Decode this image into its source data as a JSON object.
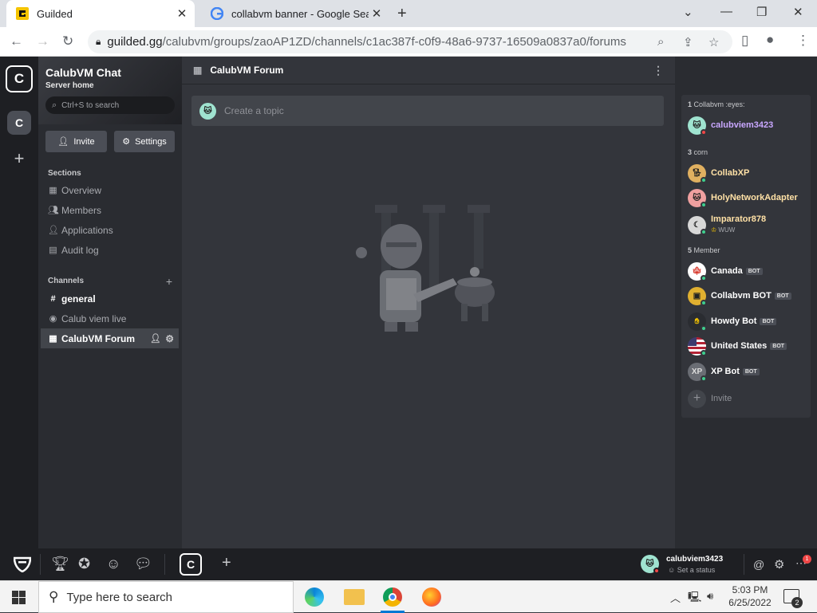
{
  "browser": {
    "tabs": [
      {
        "title": "Guilded"
      },
      {
        "title": "collabvm banner - Google Search"
      }
    ],
    "url_host": "guilded.gg",
    "url_path": "/calubvm/groups/zaoAP1ZD/channels/c1ac387f-c0f9-48a6-9737-16509a0837a0/forums"
  },
  "server": {
    "initial": "C",
    "name": "CalubVM Chat",
    "subtitle": "Server home",
    "search_placeholder": "Ctrl+S to search",
    "invite_label": "Invite",
    "settings_label": "Settings"
  },
  "sections": {
    "label": "Sections",
    "items": [
      {
        "label": "Overview",
        "icon": "grid-icon"
      },
      {
        "label": "Members",
        "icon": "people-icon"
      },
      {
        "label": "Applications",
        "icon": "person-add-icon"
      },
      {
        "label": "Audit log",
        "icon": "document-icon"
      }
    ]
  },
  "channels": {
    "label": "Channels",
    "items": [
      {
        "label": "general",
        "icon": "hash-icon"
      },
      {
        "label": "Calub viem live",
        "icon": "broadcast-icon"
      },
      {
        "label": "CalubVM Forum",
        "icon": "forum-icon"
      }
    ]
  },
  "main": {
    "title": "CalubVM Forum",
    "composer_placeholder": "Create a topic"
  },
  "members": {
    "groups": [
      {
        "label": "Collabvm :eyes:",
        "count": "1"
      },
      {
        "label": "corn",
        "count": "3"
      },
      {
        "label": "Member",
        "count": "5"
      }
    ],
    "people": [
      {
        "name": "calubviem3423",
        "status": "",
        "bot": "",
        "color": "#c9a7ff"
      },
      {
        "name": "CollabXP",
        "status": "",
        "bot": "",
        "color": "#ffe1a6"
      },
      {
        "name": "HolyNetworkAdapter",
        "status": "",
        "bot": "",
        "color": "#ffe1a6"
      },
      {
        "name": "Imparator878",
        "status": "WUW",
        "bot": "",
        "color": "#ffe1a6"
      },
      {
        "name": "Canada",
        "status": "",
        "bot": "BOT",
        "color": "#ffffff"
      },
      {
        "name": "Collabvm BOT",
        "status": "",
        "bot": "BOT",
        "color": "#ffffff"
      },
      {
        "name": "Howdy Bot",
        "status": "",
        "bot": "BOT",
        "color": "#ffffff"
      },
      {
        "name": "United States",
        "status": "",
        "bot": "BOT",
        "color": "#ffffff"
      },
      {
        "name": "XP Bot",
        "status": "",
        "bot": "BOT",
        "color": "#ffffff"
      }
    ],
    "invite_label": "Invite"
  },
  "bottom_bar": {
    "username": "calubviem3423",
    "status_prompt": "Set a status",
    "notif_count": "1"
  },
  "taskbar": {
    "search_placeholder": "Type here to search",
    "time": "5:03 PM",
    "date": "6/25/2022",
    "notif_count": "2"
  },
  "colors": {
    "accent": "#f5c400",
    "online": "#3fcf8e",
    "dnd": "#f04747"
  }
}
